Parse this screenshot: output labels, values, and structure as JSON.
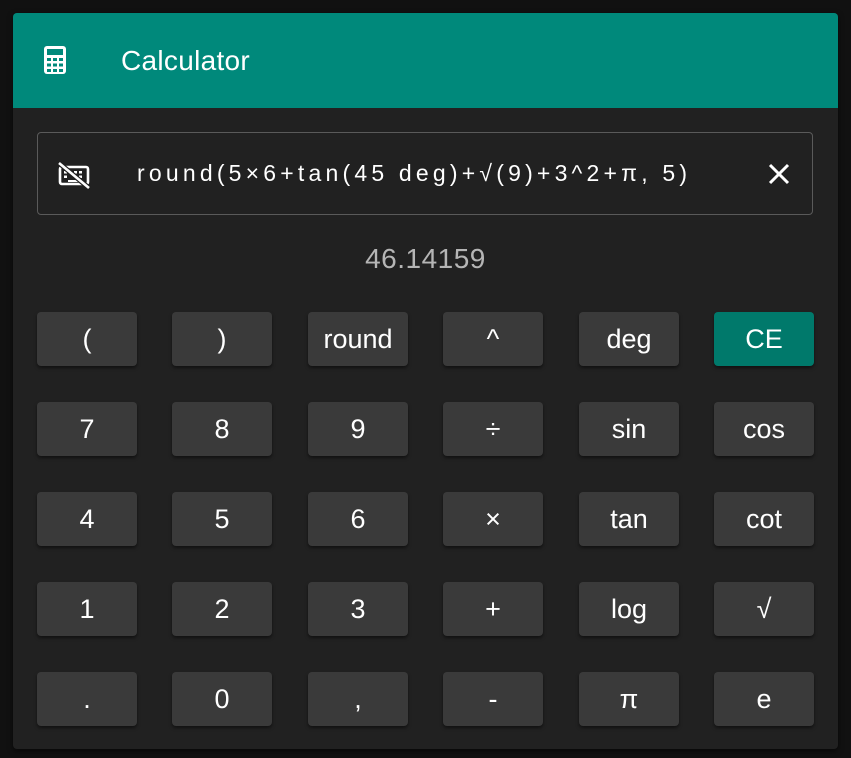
{
  "app": {
    "title": "Calculator",
    "icon": "calculator-icon",
    "accent_color": "#00897b"
  },
  "input": {
    "icon": "keyboard-off-icon",
    "expression": "round(5×6+tan(45 deg)+√(9)+3^2+π, 5)",
    "clear_icon": "close-icon"
  },
  "result": "46.14159",
  "keys": [
    [
      "(",
      ")",
      "round",
      "^",
      "deg",
      "CE"
    ],
    [
      "7",
      "8",
      "9",
      "÷",
      "sin",
      "cos"
    ],
    [
      "4",
      "5",
      "6",
      "×",
      "tan",
      "cot"
    ],
    [
      "1",
      "2",
      "3",
      "+",
      "log",
      "√"
    ],
    [
      ".",
      "0",
      ",",
      "-",
      "π",
      "e"
    ]
  ],
  "key_names": [
    [
      "open-paren-key",
      "close-paren-key",
      "round-key",
      "power-key",
      "deg-key",
      "clear-entry-key"
    ],
    [
      "digit-7-key",
      "digit-8-key",
      "digit-9-key",
      "divide-key",
      "sin-key",
      "cos-key"
    ],
    [
      "digit-4-key",
      "digit-5-key",
      "digit-6-key",
      "multiply-key",
      "tan-key",
      "cot-key"
    ],
    [
      "digit-1-key",
      "digit-2-key",
      "digit-3-key",
      "plus-key",
      "log-key",
      "sqrt-key"
    ],
    [
      "decimal-point-key",
      "digit-0-key",
      "comma-key",
      "minus-key",
      "pi-key",
      "e-key"
    ]
  ],
  "accent_keys": [
    "CE"
  ]
}
